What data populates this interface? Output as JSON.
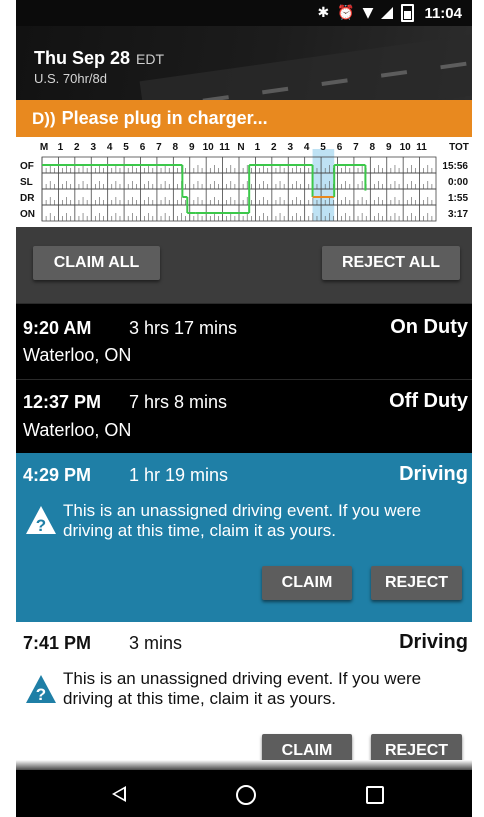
{
  "status_bar": {
    "bluetooth_glyph": "✱",
    "alarm_glyph": "⏰",
    "wifi_glyph": "▼",
    "time": "11:04"
  },
  "header": {
    "date": "Thu Sep 28",
    "timezone": "EDT",
    "cycle": "U.S. 70hr/8d"
  },
  "banner": {
    "icon_text": "D))",
    "message": "Please plug in charger...",
    "color": "#e8891f"
  },
  "log_grid": {
    "hour_labels": [
      "M",
      "1",
      "2",
      "3",
      "4",
      "5",
      "6",
      "7",
      "8",
      "9",
      "10",
      "11",
      "N",
      "1",
      "2",
      "3",
      "4",
      "5",
      "6",
      "7",
      "8",
      "9",
      "10",
      "11"
    ],
    "total_label": "TOT",
    "rows": [
      {
        "label": "OF",
        "total": "15:56"
      },
      {
        "label": "SL",
        "total": "0:00"
      },
      {
        "label": "DR",
        "total": "1:55"
      },
      {
        "label": "ON",
        "total": "3:17"
      }
    ],
    "line_color": "#3cc84a",
    "highlight_color": "#a8d8f0",
    "segments": [
      {
        "status": "OF",
        "start_hour": 0,
        "end_hour": 8.55
      },
      {
        "status": "DR",
        "start_hour": 8.55,
        "end_hour": 8.85
      },
      {
        "status": "ON",
        "start_hour": 8.85,
        "end_hour": 9.33
      },
      {
        "status": "ON",
        "start_hour": 9.33,
        "end_hour": 12.62
      },
      {
        "status": "OF",
        "start_hour": 12.62,
        "end_hour": 16.48
      },
      {
        "status": "DR",
        "start_hour": 16.48,
        "end_hour": 17.8
      },
      {
        "status": "OF",
        "start_hour": 17.8,
        "end_hour": 19.7
      }
    ],
    "highlight": {
      "start_hour": 16.48,
      "end_hour": 17.8
    },
    "highlight_segment_color": "#e8891f"
  },
  "actions": {
    "claim_all": "CLAIM ALL",
    "reject_all": "REJECT ALL"
  },
  "events": [
    {
      "time": "9:20 AM",
      "duration": "3 hrs 17 mins",
      "status": "On Duty",
      "location": "Waterloo, ON"
    },
    {
      "time": "12:37 PM",
      "duration": "7 hrs 8 mins",
      "status": "Off Duty",
      "location": "Waterloo, ON"
    },
    {
      "time": "4:29 PM",
      "duration": "1 hr 19 mins",
      "status": "Driving",
      "message": "This is an unassigned driving event. If you were driving at this time, claim it as yours.",
      "claim": "CLAIM",
      "reject": "REJECT"
    },
    {
      "time": "7:41 PM",
      "duration": "3 mins",
      "status": "Driving",
      "message": "This is an unassigned driving event. If you were driving at this time, claim it as yours.",
      "claim": "CLAIM",
      "reject": "REJECT"
    }
  ],
  "colors": {
    "selected_event": "#1f7fa6",
    "button": "#5d5d5d",
    "action_bar": "#3c3c3c"
  }
}
